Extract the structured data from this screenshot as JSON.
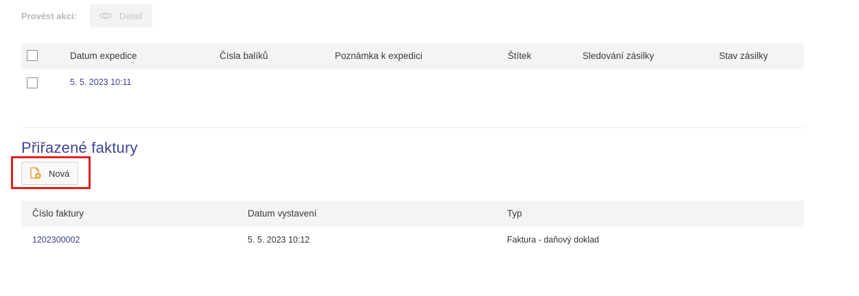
{
  "actions": {
    "label": "Provést akci:",
    "detail_button": "Detail"
  },
  "shipments_table": {
    "columns": [
      "Datum expedice",
      "Čísla balíků",
      "Poznámka k expedici",
      "Štítek",
      "Sledování zásilky",
      "Stav zásilky"
    ],
    "rows": [
      {
        "datum": "5. 5. 2023 10:11",
        "cisla": "",
        "poznamka": "",
        "stitek": "",
        "sledovani": "",
        "stav": ""
      }
    ]
  },
  "invoices": {
    "title": "Přiřazené faktury",
    "new_button": "Nová",
    "columns": [
      "Číslo faktury",
      "Datum vystavení",
      "Typ"
    ],
    "rows": [
      {
        "cislo": "1202300002",
        "datum": "5. 5. 2023 10:12",
        "typ": "Faktura - daňový doklad"
      }
    ]
  },
  "colors": {
    "accent": "#3f4591",
    "highlight": "#e01e1e",
    "header_bg": "#f4f4f5",
    "icon_orange": "#f0a030"
  },
  "icons": {
    "detail": "eye-icon",
    "new": "document-add-icon"
  }
}
